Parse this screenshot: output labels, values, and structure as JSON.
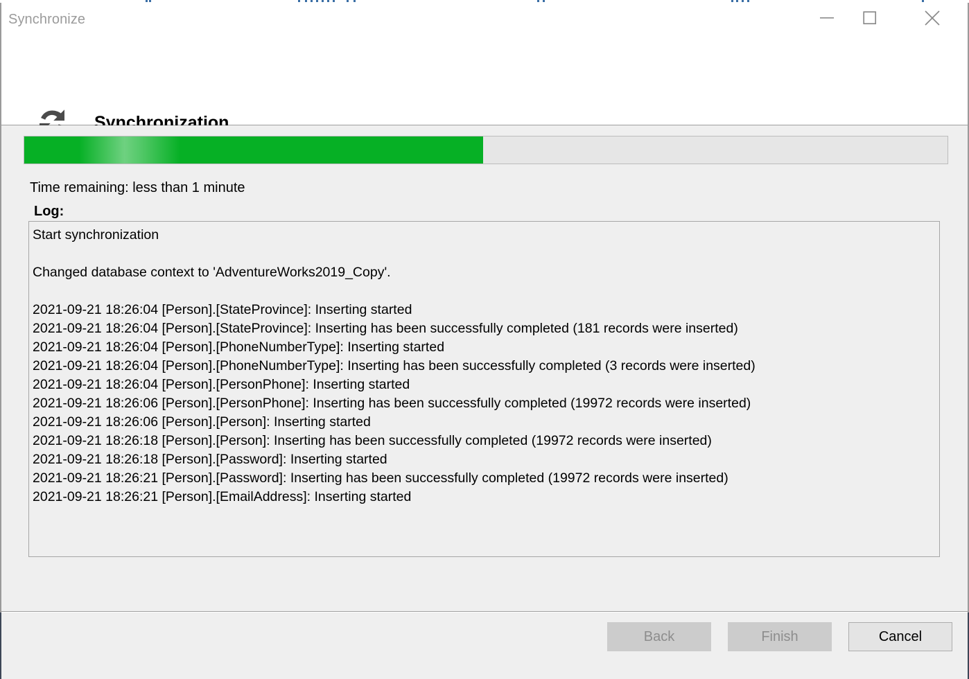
{
  "window": {
    "title": "Synchronize",
    "controls": {
      "minimize": "minimize-icon",
      "maximize": "maximize-icon",
      "close": "close-icon"
    }
  },
  "header": {
    "icon": "sync-refresh-icon",
    "title": "Synchronization"
  },
  "progress": {
    "percent": 49.7,
    "fill_color": "#06b025",
    "track_color": "#e6e6e6"
  },
  "status": {
    "time_remaining": "Time remaining: less than 1 minute",
    "log_label": "Log:"
  },
  "log": {
    "lines": [
      "Start synchronization",
      "",
      "Changed database context to 'AdventureWorks2019_Copy'.",
      "",
      "2021-09-21 18:26:04 [Person].[StateProvince]: Inserting started",
      "2021-09-21 18:26:04 [Person].[StateProvince]: Inserting has been successfully completed (181 records were inserted)",
      "2021-09-21 18:26:04 [Person].[PhoneNumberType]: Inserting started",
      "2021-09-21 18:26:04 [Person].[PhoneNumberType]: Inserting has been successfully completed (3 records were inserted)",
      "2021-09-21 18:26:04 [Person].[PersonPhone]: Inserting started",
      "2021-09-21 18:26:06 [Person].[PersonPhone]: Inserting has been successfully completed (19972 records were inserted)",
      "2021-09-21 18:26:06 [Person].[Person]: Inserting started",
      "2021-09-21 18:26:18 [Person].[Person]: Inserting has been successfully completed (19972 records were inserted)",
      "2021-09-21 18:26:18 [Person].[Password]: Inserting started",
      "2021-09-21 18:26:21 [Person].[Password]: Inserting has been successfully completed (19972 records were inserted)",
      "2021-09-21 18:26:21 [Person].[EmailAddress]: Inserting started"
    ]
  },
  "footer": {
    "buttons": [
      {
        "label": "Back",
        "enabled": false
      },
      {
        "label": "Finish",
        "enabled": false
      },
      {
        "label": "Cancel",
        "enabled": true
      }
    ]
  }
}
